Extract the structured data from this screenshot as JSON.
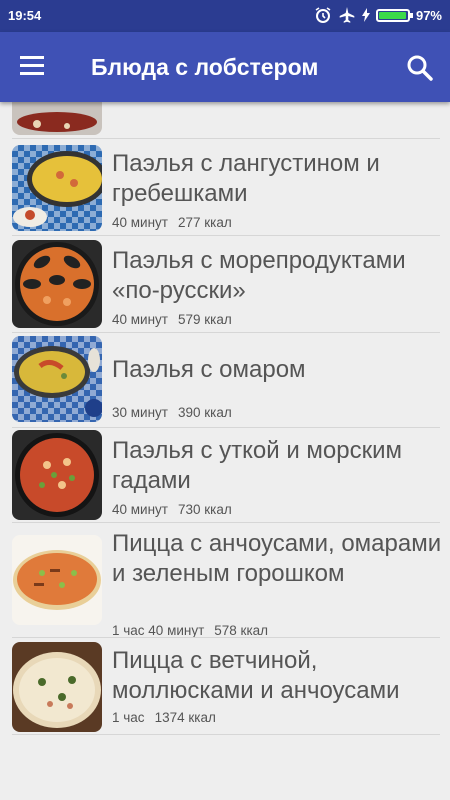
{
  "status": {
    "time": "19:54",
    "battery": "97%",
    "battery_level": 0.97
  },
  "appbar": {
    "title": "Блюда с лобстером",
    "menu_icon": "menu-icon",
    "search_icon": "search-icon"
  },
  "recipes": [
    {
      "title": "Паэлья с лангустином и гребешками",
      "time": "40 минут",
      "kcal": "277 ккал"
    },
    {
      "title": "Паэлья с морепродуктами «по-русски»",
      "time": "40 минут",
      "kcal": "579 ккал"
    },
    {
      "title": "Паэлья с омаром",
      "time": "30 минут",
      "kcal": "390 ккал"
    },
    {
      "title": "Паэлья с уткой и морским гадами",
      "time": "40 минут",
      "kcal": "730 ккал"
    },
    {
      "title": "Пицца с анчоусами, омарами и зеленым горошком",
      "time": "1 час 40 минут",
      "kcal": "578 ккал"
    },
    {
      "title": "Пицца с ветчиной, моллюсками и анчоусами",
      "time": "1 час",
      "kcal": "1374 ккал"
    }
  ]
}
